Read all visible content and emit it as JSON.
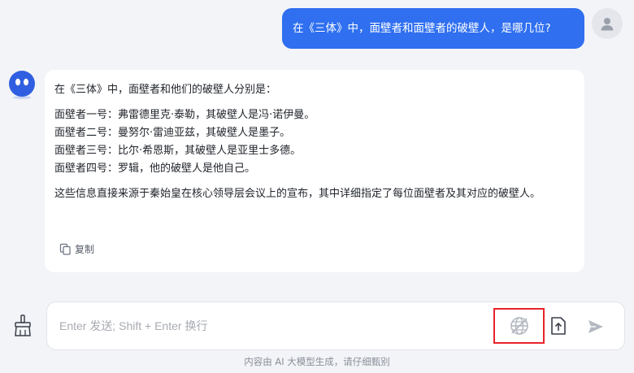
{
  "user_message": {
    "text": "在《三体》中，面壁者和面壁者的破壁人，是哪几位?"
  },
  "assistant_message": {
    "intro": "在《三体》中，面壁者和他们的破壁人分别是：",
    "items": [
      "面壁者一号：弗雷德里克·泰勒，其破壁人是冯·诺伊曼。",
      "面壁者二号：曼努尔·雷迪亚兹，其破壁人是墨子。",
      "面壁者三号：比尔·希恩斯，其破壁人是亚里士多德。",
      "面壁者四号：罗辑，他的破壁人是他自己。"
    ],
    "summary": "这些信息直接来源于秦始皇在核心领导层会议上的宣布，其中详细指定了每位面壁者及其对应的破壁人。",
    "copy_label": "复制"
  },
  "composer": {
    "placeholder": "Enter 发送; Shift + Enter 换行",
    "value": ""
  },
  "disclaimer": "内容由 AI 大模型生成，请仔细甄别",
  "colors": {
    "accent": "#2f6ff0",
    "highlight_border": "#e8232a",
    "background": "#f3f4f7"
  },
  "icons": {
    "user_avatar": "person-icon",
    "bot_avatar": "robot-icon",
    "copy": "copy-icon",
    "clear": "broom-icon",
    "web_search_disabled": "globe-off-icon",
    "upload": "file-upload-icon",
    "send": "send-icon"
  }
}
